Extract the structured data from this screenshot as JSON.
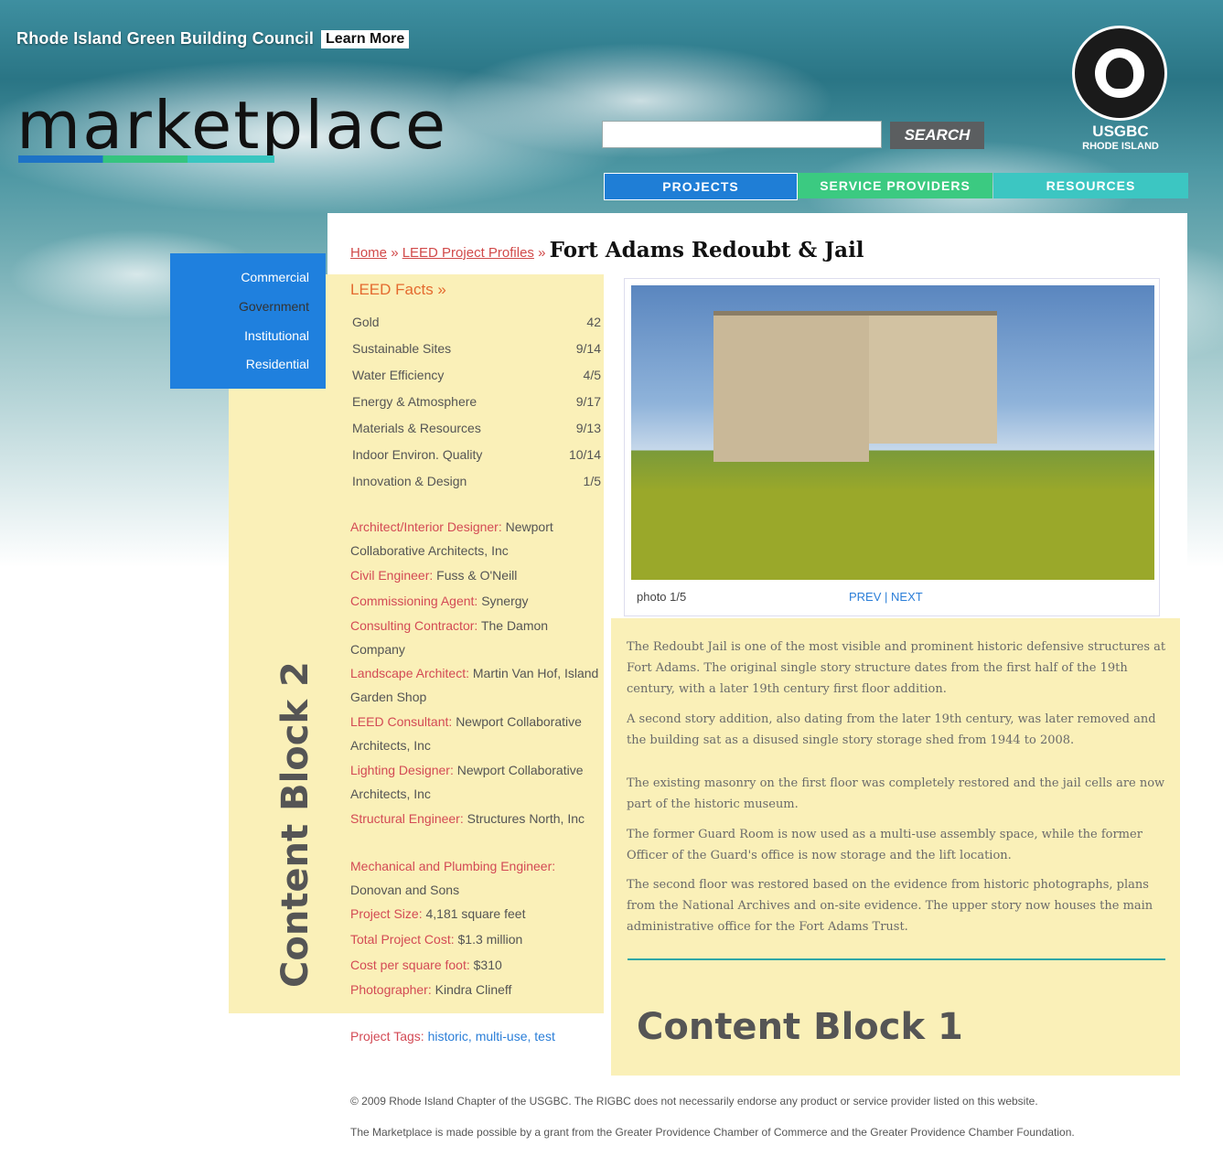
{
  "header": {
    "council_name": "Rhode Island Green Building Council",
    "learn_more": "Learn More",
    "logo": "marketplace",
    "search_button": "SEARCH",
    "search_placeholder": "",
    "usgbc_line1": "USGBC",
    "usgbc_line2": "RHODE ISLAND",
    "nav": [
      "PROJECTS",
      "SERVICE PROVIDERS",
      "RESOURCES"
    ]
  },
  "sidebar": {
    "items": [
      "Commercial",
      "Government",
      "Institutional",
      "Residential"
    ]
  },
  "breadcrumb": {
    "home": "Home",
    "sep": "»",
    "section": "LEED Project Profiles",
    "title": "Fort Adams Redoubt & Jail"
  },
  "leed_facts": {
    "title": "LEED Facts »",
    "rows": [
      {
        "label": "Gold",
        "value": "42"
      },
      {
        "label": "Sustainable Sites",
        "value": "9/14"
      },
      {
        "label": "Water Efficiency",
        "value": "4/5"
      },
      {
        "label": "Energy & Atmosphere",
        "value": "9/17"
      },
      {
        "label": "Materials & Resources",
        "value": "9/13"
      },
      {
        "label": "Indoor Environ. Quality",
        "value": "10/14"
      },
      {
        "label": "Innovation & Design",
        "value": "1/5"
      }
    ]
  },
  "credits": [
    {
      "role": "Architect/Interior Designer:",
      "name": "Newport Collaborative Architects, Inc"
    },
    {
      "role": "Civil Engineer:",
      "name": "Fuss & O'Neill"
    },
    {
      "role": "Commissioning Agent:",
      "name": "Synergy"
    },
    {
      "role": "Consulting Contractor:",
      "name": "The Damon Company"
    },
    {
      "role": "Landscape Architect:",
      "name": "Martin Van Hof, Island Garden Shop"
    },
    {
      "role": "LEED Consultant:",
      "name": "Newport Collaborative Architects, Inc"
    },
    {
      "role": "Lighting Designer:",
      "name": "Newport Collaborative Architects, Inc"
    },
    {
      "role": "Structural Engineer:",
      "name": "Structures North, Inc"
    },
    {
      "role": "Mechanical and Plumbing Engineer:",
      "name": "Donovan and Sons"
    },
    {
      "role": "Project Size:",
      "name": "4,181 square feet"
    },
    {
      "role": "Total Project Cost:",
      "name": "$1.3 million"
    },
    {
      "role": "Cost per square foot:",
      "name": "$310"
    },
    {
      "role": "Photographer:",
      "name": "Kindra Clineff"
    }
  ],
  "tags": {
    "label": "Project Tags:",
    "items": [
      "historic,",
      "multi-use,",
      "test"
    ]
  },
  "photo": {
    "caption": "photo 1/5",
    "prev": "PREV",
    "sep": "|",
    "next": "NEXT"
  },
  "description": [
    "The Redoubt Jail is one of the most visible and prominent historic defensive structures at Fort Adams. The original single story structure dates from the first half of the 19th century, with a later 19th century first floor addition.",
    "A second story addition, also dating from the later 19th century, was later removed and the building sat as a disused single story storage shed from 1944 to 2008.",
    "The existing masonry on the first floor was completely restored and the jail cells are now part of the historic museum.",
    "The former Guard Room is now used as a multi-use assembly space, while the former Officer of the Guard's office is now storage and the lift location.",
    "The second floor was restored based on the evidence from historic photographs, plans from the National Archives and on-site evidence. The upper story now houses the main administrative office for the Fort Adams Trust."
  ],
  "annotations": {
    "block1": "Content Block 1",
    "block2": "Content Block 2"
  },
  "footer": {
    "copyright": "© 2009 Rhode Island Chapter of the USGBC. The RIGBC does not necessarily endorse any product or service provider listed on this website.",
    "grant": "The Marketplace is made possible by a grant from the Greater Providence Chamber of Commerce and the Greater Providence Chamber Foundation."
  }
}
